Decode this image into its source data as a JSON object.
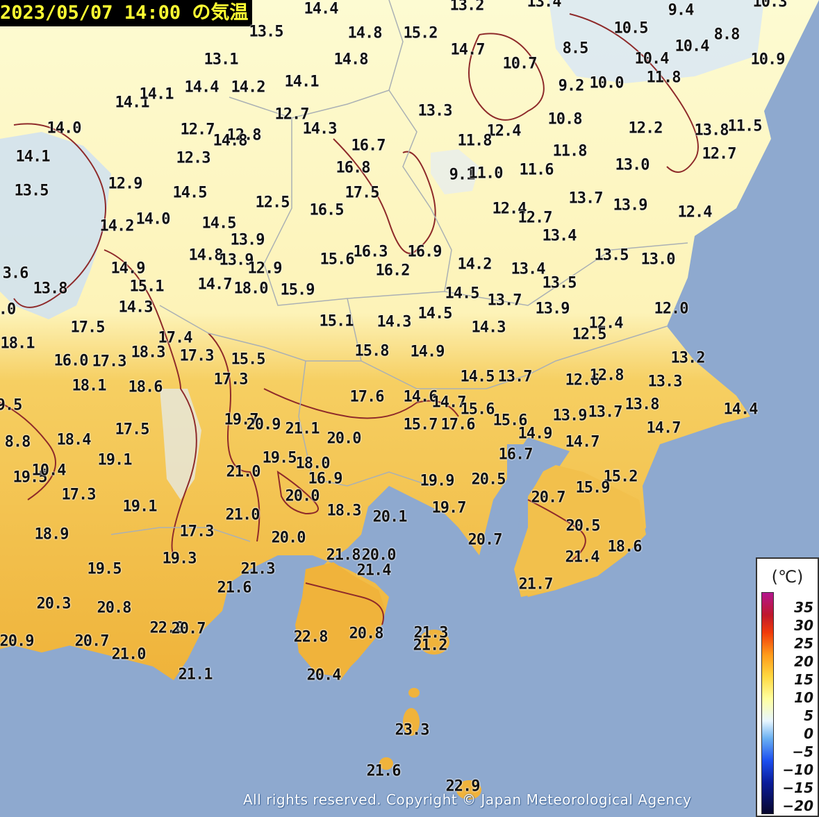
{
  "header": {
    "title": "2023/05/07 14:00 の気温"
  },
  "legend": {
    "unit": "(℃)",
    "ticks": [
      "35",
      "30",
      "25",
      "20",
      "15",
      "10",
      "5",
      "0",
      "−5",
      "−10",
      "−15",
      "−20"
    ]
  },
  "copyright": "All rights reserved. Copyright © Japan Meteorological Agency",
  "colors": {
    "sea": "#8ea9cf",
    "cool": "#fdfbd2",
    "warm": "#f0b43a",
    "cold": "#d6e6f4",
    "contour": "#8e2a2a"
  },
  "observations": [
    "14.4",
    "13.2",
    "13.4",
    "9.4",
    "10.3",
    "10.5",
    "8.8",
    "13.5",
    "14.8",
    "15.2",
    "14.7",
    "8.5",
    "10.4",
    "10.4",
    "10.9",
    "13.1",
    "14.8",
    "10.7",
    "11.8",
    "9.2",
    "10.0",
    "14.1",
    "14.1",
    "14.4",
    "14.2",
    "14.1",
    "12.7",
    "13.3",
    "10.8",
    "14.0",
    "12.7",
    "12.8",
    "14.3",
    "14.8",
    "12.4",
    "11.8",
    "12.2",
    "13.8",
    "11.5",
    "14.1",
    "12.3",
    "16.7",
    "11.8",
    "12.7",
    "16.8",
    "9.1",
    "11.0",
    "11.6",
    "13.0",
    "13.5",
    "12.9",
    "14.5",
    "17.5",
    "12.5",
    "16.5",
    "13.7",
    "13.9",
    "12.4",
    "14.2",
    "14.0",
    "14.5",
    "12.4",
    "12.7",
    "13.9",
    "13.4",
    "14.8",
    "13.9",
    "16.3",
    "16.9",
    "13.5",
    "13.0",
    "15.6",
    "16.2",
    "14.2",
    "13.4",
    "3.6",
    "14.9",
    "12.9",
    "13.8",
    "15.1",
    "14.7",
    "18.0",
    "15.9",
    "13.5",
    "14.5",
    ".0",
    "14.3",
    "13.7",
    "13.9",
    "12.0",
    "12.4",
    "15.1",
    "14.3",
    "14.5",
    "14.3",
    "17.5",
    "12.5",
    "17.4",
    "18.1",
    "18.3",
    "17.3",
    "15.5",
    "15.8",
    "14.9",
    "13.2",
    "16.0",
    "17.3",
    "17.3",
    "14.5",
    "13.7",
    "12.6",
    "12.8",
    "13.3",
    "18.1",
    "18.6",
    "9.5",
    "17.6",
    "14.6",
    "14.7",
    "15.6",
    "13.8",
    "14.4",
    "19.7",
    "20.9",
    "21.1",
    "15.7",
    "17.6",
    "15.6",
    "13.9",
    "13.7",
    "14.7",
    "17.5",
    "8.8",
    "18.4",
    "20.0",
    "14.9",
    "14.7",
    "19.1",
    "19.5",
    "18.0",
    "16.7",
    "19.5",
    "10.4",
    "21.0",
    "16.9",
    "19.9",
    "20.5",
    "15.2",
    "15.9",
    "17.3",
    "19.1",
    "20.0",
    "20.7",
    "18.3",
    "20.1",
    "19.7",
    "21.0",
    "20.5",
    "18.9",
    "17.3",
    "20.0",
    "20.7",
    "18.6",
    "21.8",
    "20.0",
    "19.3",
    "21.4",
    "19.5",
    "21.3",
    "21.4",
    "21.7",
    "21.6",
    "20.3",
    "20.8",
    "22.0",
    "20.7",
    "20.9",
    "20.7",
    "22.8",
    "20.8",
    "21.3",
    "21.2",
    "21.0",
    "21.1",
    "20.4",
    "23.3",
    "21.6",
    "22.9"
  ]
}
